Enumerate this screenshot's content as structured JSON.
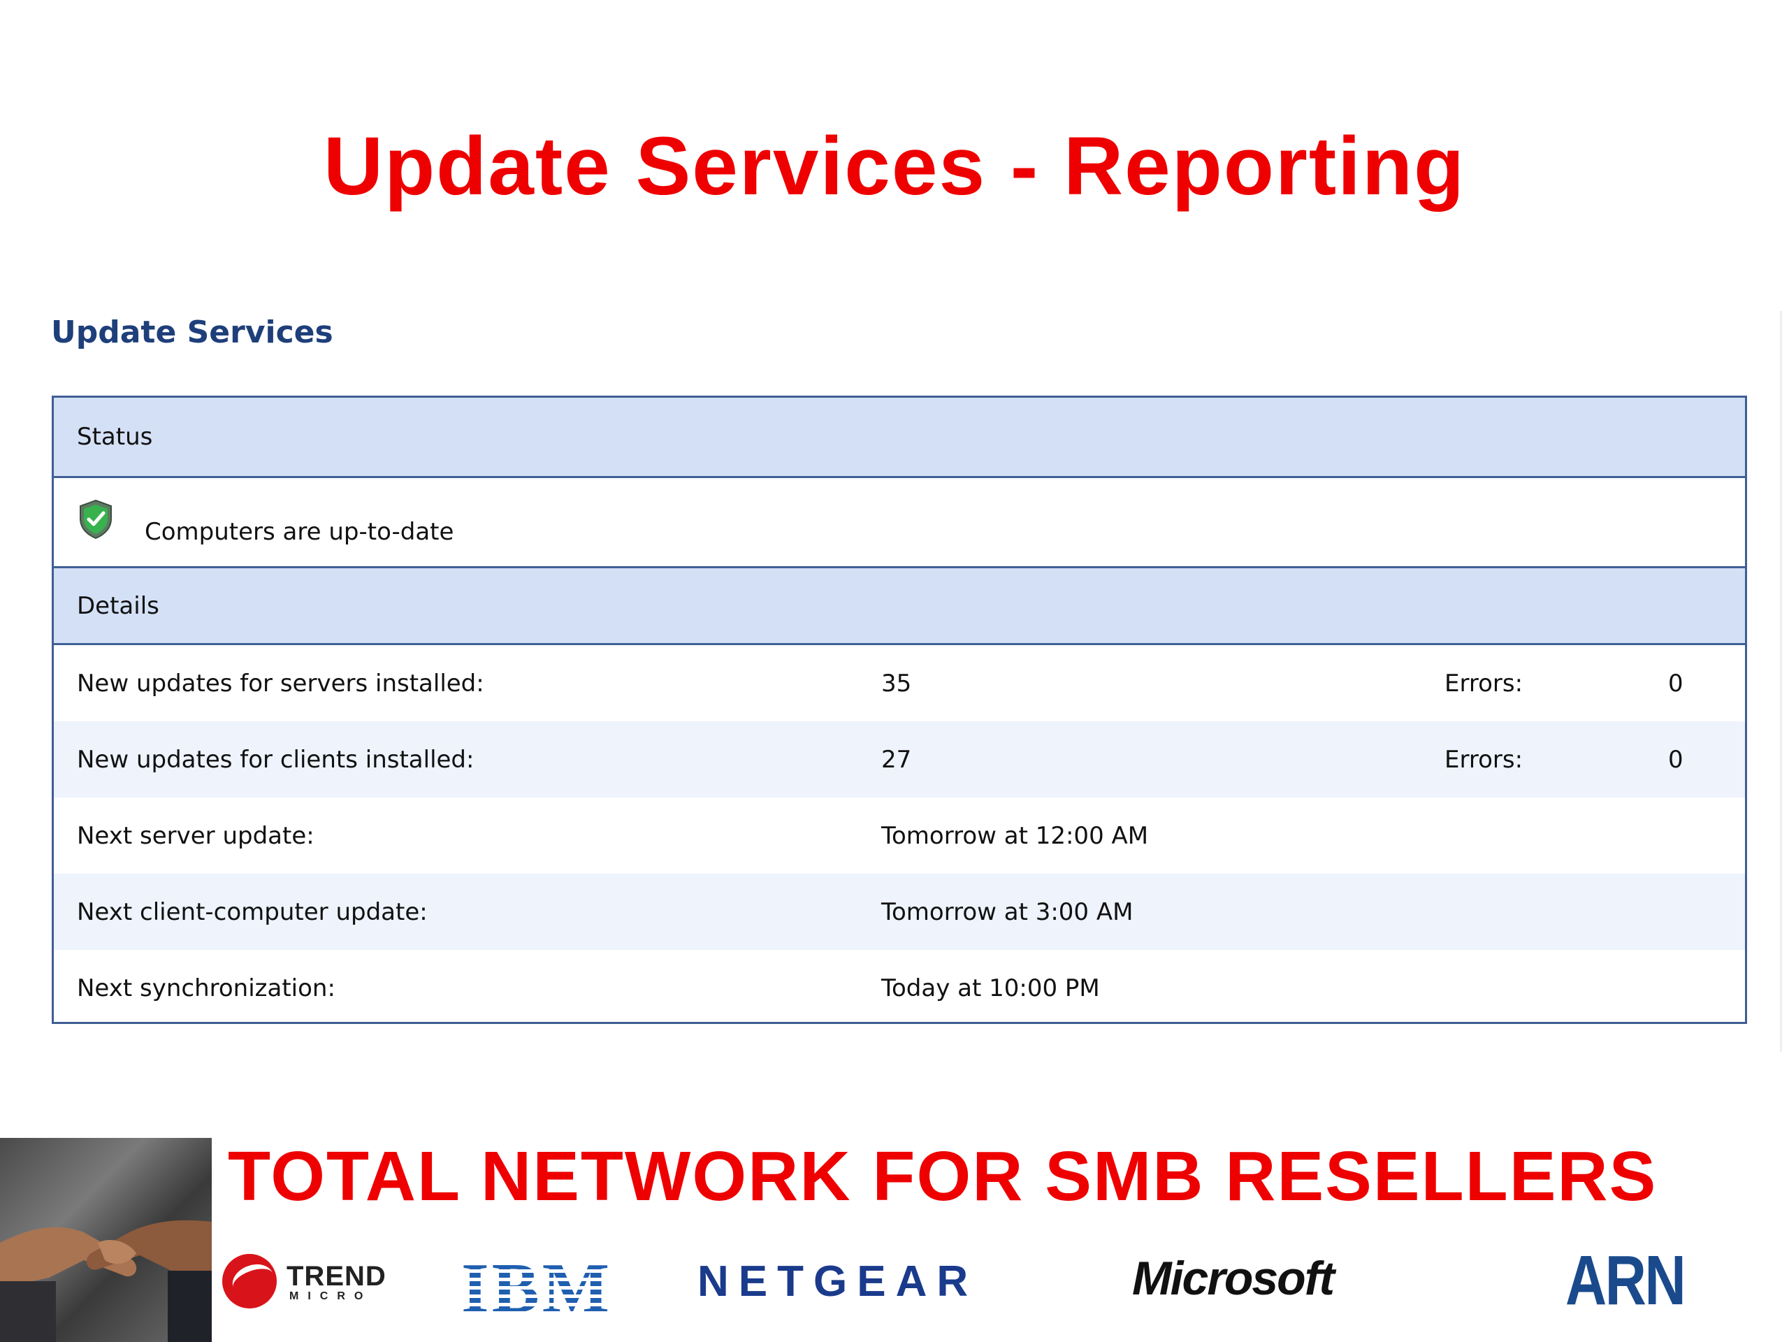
{
  "slide": {
    "title": "Update Services - Reporting"
  },
  "console": {
    "heading": "Update Services",
    "status_header": "Status",
    "status_text": "Computers are up-to-date",
    "details_header": "Details",
    "rows": [
      {
        "label": "New updates for servers installed:",
        "value": "35",
        "err_label": "Errors:",
        "err_value": "0"
      },
      {
        "label": "New updates for clients installed:",
        "value": "27",
        "err_label": "Errors:",
        "err_value": "0"
      },
      {
        "label": "Next server update:",
        "value": "Tomorrow at 12:00 AM"
      },
      {
        "label": "Next client-computer update:",
        "value": "Tomorrow at 3:00 AM"
      },
      {
        "label": "Next synchronization:",
        "value": "Today at 10:00 PM"
      }
    ]
  },
  "footer": {
    "title": "TOTAL NETWORK FOR SMB RESELLERS",
    "logos": {
      "trend_word": "TREND",
      "trend_sub": "MICRO",
      "ibm": "IBM",
      "netgear": "NETGEAR",
      "microsoft": "Microsoft",
      "arn": "ARN"
    }
  },
  "colors": {
    "title_red": "#ee0000",
    "band_blue": "#d4e0f6",
    "border_blue": "#3f5f94",
    "heading_blue": "#1e3f7a"
  },
  "icons": {
    "status": "shield-check-icon",
    "footer_photo": "handshake-image"
  }
}
